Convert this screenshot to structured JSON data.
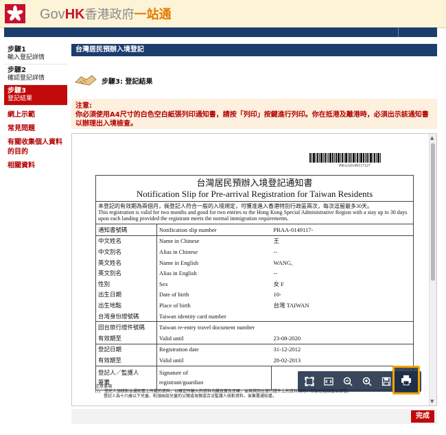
{
  "header": {
    "logo_gov": "Gov",
    "logo_hk": "HK",
    "logo_cn": "香港政府",
    "logo_cn2": "一站通"
  },
  "sidebar": {
    "steps": [
      {
        "title": "步驟1",
        "subtitle": "輸入登記詳情"
      },
      {
        "title": "步驟2",
        "subtitle": "確認登記詳情"
      },
      {
        "title": "步驟3",
        "subtitle": "登記結果"
      }
    ],
    "links": [
      "網上示範",
      "常見問題",
      "有關收集個人資料的目的",
      "相關資料"
    ]
  },
  "main": {
    "title": "台灣居民預辦入境登記",
    "step_label": "步驟3: 登記結果",
    "notice_head": "注意:",
    "notice_body": "你必須使用A4尺寸的白色空白紙張列印通知書，請按「列印」按鍵進行列印。你在抵港及離港時，必須出示該通知書以辦理出入境檢查。",
    "done_label": "完成"
  },
  "slip": {
    "barcode_number": "PRAA0149117127",
    "title_cn": "台灣居民預辦入境登記通知書",
    "title_en": "Notification Slip for Pre-arrival Registration for Taiwan Residents",
    "note_cn": "本登記的有效期為兩個月，倘登記人符合一般的入境規定，可獲准進入香港特別行政區兩次，每次逗留最多30天。",
    "note_en": "This registration is valid for two months and good for two entries to the Hong Kong Special Administrative Region with a stay up to 30 days upon each landing provided the registrant meets the normal immigration requirements.",
    "rows": [
      {
        "cn": "通知書號碼",
        "en": "Notification slip number",
        "value": "PRAA-0149117-",
        "grp": true
      },
      {
        "cn": "中文姓名",
        "en": "Name in Chinese",
        "value": "王",
        "grp": true
      },
      {
        "cn": "中文別名",
        "en": "Alias in Chinese",
        "value": "--"
      },
      {
        "cn": "英文姓名",
        "en": "Name in English",
        "value": "WANG,"
      },
      {
        "cn": "英文別名",
        "en": "Alias in English",
        "value": "--"
      },
      {
        "cn": "性別",
        "en": "Sex",
        "value": "女 F"
      },
      {
        "cn": "出生日期",
        "en": "Date of birth",
        "value": "10-"
      },
      {
        "cn": "出生地點",
        "en": "Place of birth",
        "value": "台灣 TAIWAN"
      },
      {
        "cn": "台灣身份證號碼",
        "en": "Taiwan identity card number",
        "value": ""
      },
      {
        "cn": "回台旅行證件號碼",
        "en": "Taiwan re-entry travel document number",
        "value": "",
        "grp": true
      },
      {
        "cn": "有效期至",
        "en": "Valid until",
        "value": "23-08-2020"
      },
      {
        "cn": "登記日期",
        "en": "Registration date",
        "value": "31-12-2012",
        "grp": true
      },
      {
        "cn": "有效期至",
        "en": "Valid until",
        "value": "28-02-2013"
      }
    ],
    "signature_cn_1": "登記人／監護人",
    "signature_cn_2": "簽署",
    "signature_en_1": "Signature of",
    "signature_en_2": "registrant/guardian",
    "footnote_title": "注意事項",
    "footnote_1": "(1)　登記人須核對本通知書上所載的資料，以確定所輸入的資料均屬真實及正確，並與其回台旅行證件上的資料相符，然後在通知書上簽署。",
    "footnote_2": "　　登記人為十六歲以下兒童，則須由該兒童的父親或母親或合法監護人核對資料，並簽署通知書。"
  },
  "toolbar": {
    "icons": [
      "fit-page-icon",
      "fit-width-icon",
      "zoom-out-icon",
      "zoom-in-icon",
      "save-icon",
      "print-icon"
    ]
  },
  "colors": {
    "navy": "#1c3e6e",
    "red": "#c20a0a",
    "notice_bg": "#fdf0df",
    "highlight": "#f2a500"
  }
}
